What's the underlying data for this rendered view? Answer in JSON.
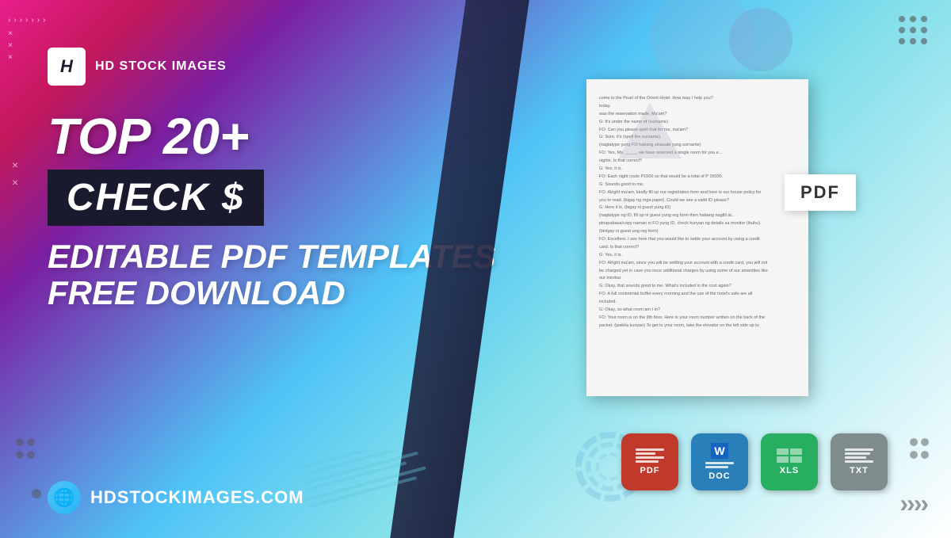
{
  "background": {
    "gradient_description": "Pink to purple to cyan to white gradient"
  },
  "logo": {
    "icon_letter": "H",
    "brand_name": "HD STOCK IMAGES",
    "icon_color": "#1a1a2e"
  },
  "headline": {
    "top_line": "TOP 20+",
    "check_badge": "CHECK $",
    "subtitle_line1": "EDITABLE PDF TEMPLATES",
    "subtitle_line2": "FREE DOWNLOAD"
  },
  "website": {
    "url": "HDSTOCKIMAGES.COM"
  },
  "pdf_badge": {
    "label": "PDF"
  },
  "format_icons": [
    {
      "type": "pdf",
      "label": "PDF",
      "color": "#c0392b"
    },
    {
      "type": "doc",
      "label": "DOC",
      "color": "#2980b9"
    },
    {
      "type": "xls",
      "label": "XLS",
      "color": "#27ae60"
    },
    {
      "type": "txt",
      "label": "TXT",
      "color": "#7f8c8d"
    }
  ],
  "document_preview": {
    "lines": [
      "come to the Pearl of the Orient Hotel. How may I help you?",
      "today.",
      "was the reservation made, Ma'am?",
      "G: It's under the name of (surname).",
      "FO: Can you please spell that for me, ma'am?",
      "G: Sure, it's (spell the surname).",
      "(nagtatype yung FO habang sinasabi yung surname)",
      "FO: Yes, Ms. _____ we have reserved a single room for you e...",
      "nights. Is that correct?",
      "G: Yes, it is.",
      "FO: Each night costs P1500 so that would be a total of P 15000.",
      "G: Sounds good to me.",
      "FO: Alright ma'am, kindly fill up our registration form and here is our house policy for",
      "you to read. (bigay ng mga papel). Could we see a valid ID please?",
      "G: Here it is. (bigay ni guest yung ID)",
      "(nagtatype ng ID, fill up ni guest yung reg form then habang nagfill at...",
      "pinapabasa/copy naman ni FO yung ID, check kunyan ng details sa monitor (ihuhu).",
      "(binigay ni guest ung reg form)",
      "FO: Excellent. I see here that you would like to settle your account by using a credit",
      "card. Is that correct?",
      "G: Yes, it is.",
      "FO: Alright ma'am, since you will be settling your account with a credit card, you will not",
      "be charged yet in case you incur additional charges by using some of our amenities like",
      "our minibar.",
      "G: Okay, that sounds good to me. What's included in the cost again?",
      "FO: A full continental buffet every morning and the use of the hotel's safe are all",
      "included.",
      "G: Okay, so what room am I in?",
      "FO: Your room is on the 9th floor. Here is your room number written on the back of the",
      "packet. (ipakita kunyan) To get to your room, take the elevator on the left side up to"
    ]
  },
  "decorations": {
    "dots_count": 9,
    "chevrons_right": ">>>",
    "x_symbols": "×",
    "chevrons_left": ">>>>>>>"
  }
}
